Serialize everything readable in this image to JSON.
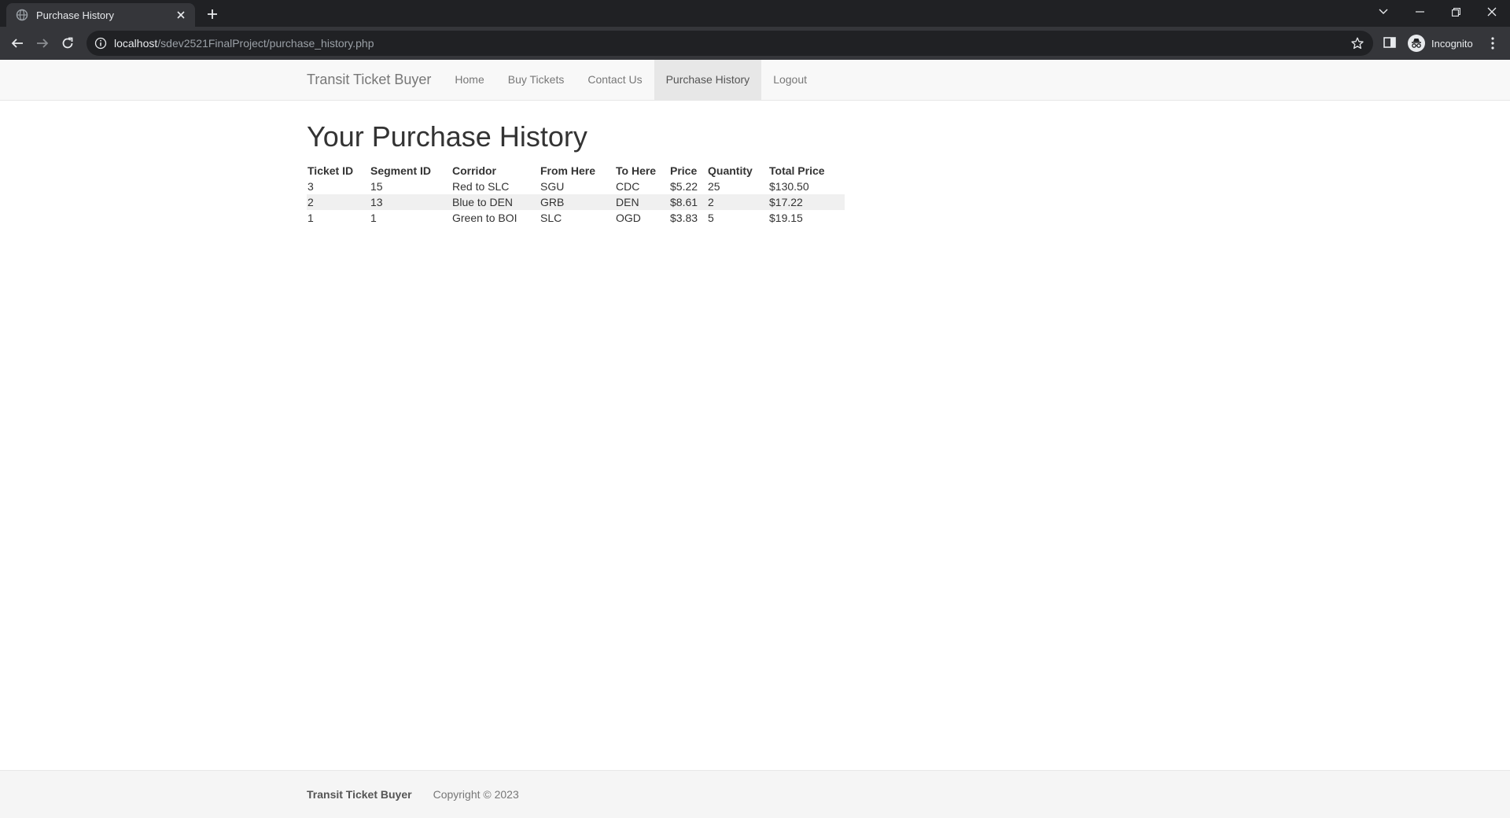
{
  "browser": {
    "tab_title": "Purchase History",
    "url_host": "localhost",
    "url_path": "/sdev2521FinalProject/purchase_history.php",
    "profile_label": "Incognito"
  },
  "navbar": {
    "brand": "Transit Ticket Buyer",
    "items": [
      {
        "label": "Home",
        "active": false
      },
      {
        "label": "Buy Tickets",
        "active": false
      },
      {
        "label": "Contact Us",
        "active": false
      },
      {
        "label": "Purchase History",
        "active": true
      },
      {
        "label": "Logout",
        "active": false
      }
    ]
  },
  "main": {
    "title": "Your Purchase History",
    "table": {
      "headers": [
        "Ticket ID",
        "Segment ID",
        "Corridor",
        "From Here",
        "To Here",
        "Price",
        "Quantity",
        "Total Price"
      ],
      "rows": [
        [
          "3",
          "15",
          "Red to SLC",
          "SGU",
          "CDC",
          "$5.22",
          "25",
          "$130.50"
        ],
        [
          "2",
          "13",
          "Blue to DEN",
          "GRB",
          "DEN",
          "$8.61",
          "2",
          "$17.22"
        ],
        [
          "1",
          "1",
          "Green to BOI",
          "SLC",
          "OGD",
          "$3.83",
          "5",
          "$19.15"
        ]
      ]
    }
  },
  "footer": {
    "brand": "Transit Ticket Buyer",
    "copyright": "Copyright © 2023"
  },
  "colors": {
    "navbar_bg": "#f8f8f8",
    "active_nav_bg": "#e7e7e7",
    "footer_bg": "#f5f5f5",
    "striped_row_bg": "#f0f0f0"
  }
}
